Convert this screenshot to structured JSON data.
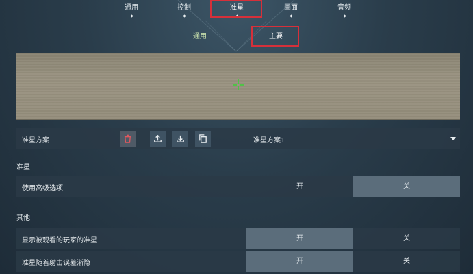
{
  "top_tabs": [
    {
      "label": "通用"
    },
    {
      "label": "控制"
    },
    {
      "label": "准星"
    },
    {
      "label": "画面"
    },
    {
      "label": "音频"
    }
  ],
  "sub_tabs": [
    {
      "label": "通用"
    },
    {
      "label": "主要"
    }
  ],
  "preview": {
    "crosshair_color": "#3fcf3a"
  },
  "profile": {
    "label": "准星方案",
    "selected": "准星方案1",
    "icons": [
      "trash-icon",
      "upload-icon",
      "download-icon",
      "copy-icon"
    ]
  },
  "sections": [
    {
      "title": "准星",
      "rows": [
        {
          "label": "使用高级选项",
          "on": "开",
          "off": "关",
          "value": "off"
        }
      ]
    },
    {
      "title": "其他",
      "rows": [
        {
          "label": "显示被观看的玩家的准星",
          "on": "开",
          "off": "关",
          "value": "on"
        },
        {
          "label": "准星随着射击误差渐隐",
          "on": "开",
          "off": "关",
          "value": "on"
        }
      ]
    }
  ],
  "colors": {
    "highlight": "#d6303a",
    "selected_option": "#5b6d7b"
  }
}
